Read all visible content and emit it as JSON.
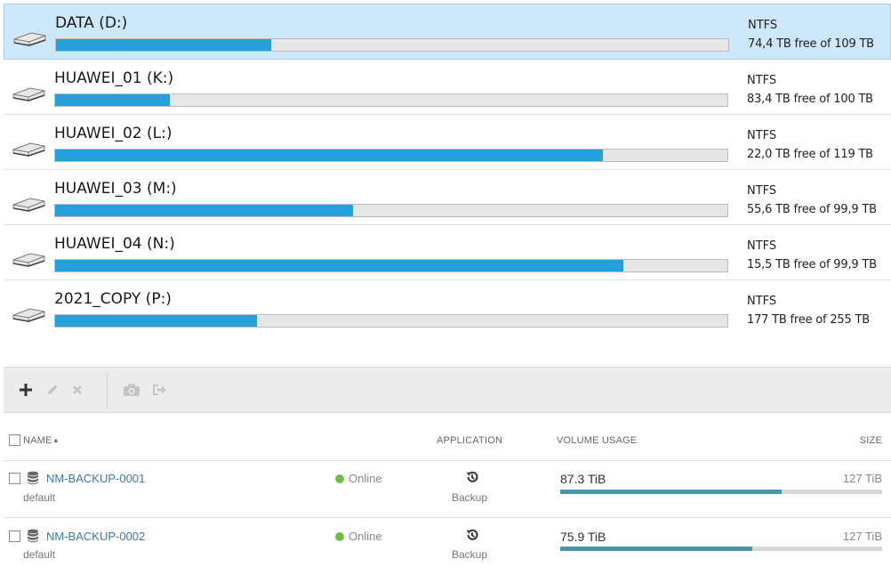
{
  "drives": [
    {
      "name": "DATA (D:)",
      "fs": "NTFS",
      "free": "74,4 TB free of 109 TB",
      "used_fraction": 0.32,
      "selected": true
    },
    {
      "name": "HUAWEI_01 (K:)",
      "fs": "NTFS",
      "free": "83,4 TB free of 100 TB",
      "used_fraction": 0.17,
      "selected": false
    },
    {
      "name": "HUAWEI_02 (L:)",
      "fs": "NTFS",
      "free": "22,0 TB free of 119 TB",
      "used_fraction": 0.815,
      "selected": false
    },
    {
      "name": "HUAWEI_03 (M:)",
      "fs": "NTFS",
      "free": "55,6 TB free of 99,9 TB",
      "used_fraction": 0.443,
      "selected": false
    },
    {
      "name": "HUAWEI_04 (N:)",
      "fs": "NTFS",
      "free": "15,5 TB free of 99,9 TB",
      "used_fraction": 0.845,
      "selected": false
    },
    {
      "name": "2021_COPY (P:)",
      "fs": "NTFS",
      "free": "177 TB free of 255 TB",
      "used_fraction": 0.3,
      "selected": false
    }
  ],
  "toolbar": {
    "add_icon": "plus-icon",
    "edit_icon": "pencil-icon",
    "delete_icon": "x-icon",
    "snapshot_icon": "camera-icon",
    "export_icon": "sign-out-icon"
  },
  "table": {
    "headers": {
      "name": "NAME",
      "application": "APPLICATION",
      "volume_usage": "VOLUME USAGE",
      "size": "SIZE"
    },
    "sort_indicator": "▴",
    "rows": [
      {
        "name": "NM-BACKUP-0001",
        "group": "default",
        "status": "Online",
        "application": "Backup",
        "usage": "87.3 TiB",
        "usage_fraction": 0.687,
        "size": "127 TiB"
      },
      {
        "name": "NM-BACKUP-0002",
        "group": "default",
        "status": "Online",
        "application": "Backup",
        "usage": "75.9 TiB",
        "usage_fraction": 0.597,
        "size": "127 TiB"
      }
    ]
  },
  "colors": {
    "drive_bar": "#26a0da",
    "selection_bg": "#cde8fb",
    "usage_bar": "#4a97ac",
    "status_online": "#6cc04a",
    "link": "#3a78a8"
  }
}
